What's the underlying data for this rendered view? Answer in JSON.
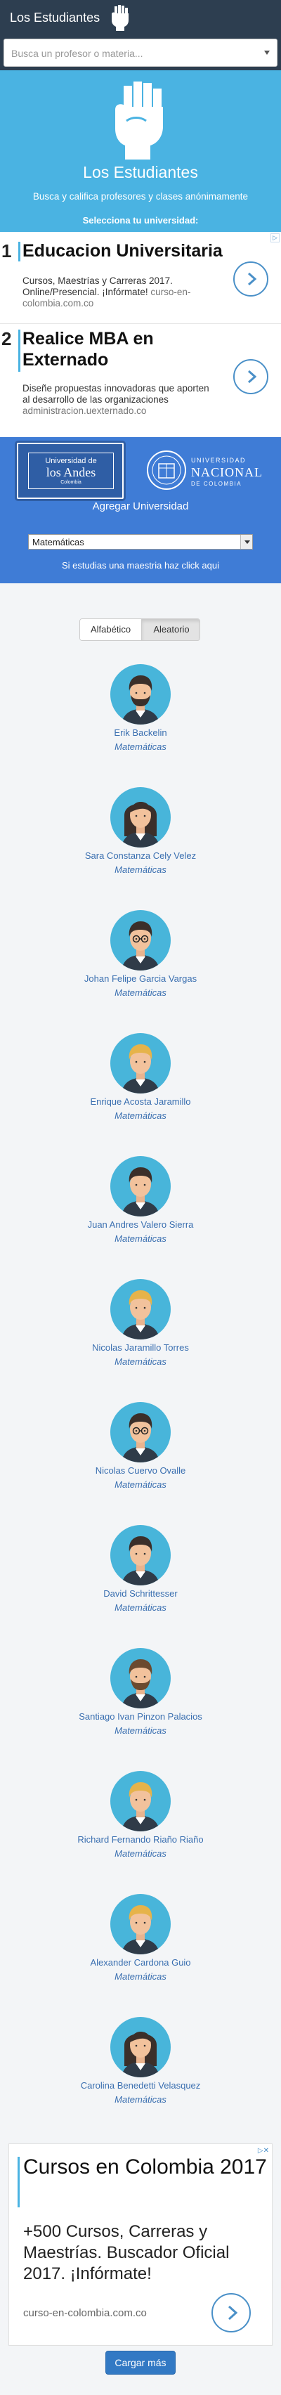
{
  "navbar": {
    "brand": "Los Estudiantes"
  },
  "search": {
    "placeholder": "Busca un profesor o materia..."
  },
  "hero": {
    "title": "Los Estudiantes",
    "subtitle": "Busca y califica profesores y clases anónimamente",
    "select_prompt": "Selecciona tu universidad:"
  },
  "ads": [
    {
      "number": "1",
      "title": "Educacion Universitaria",
      "text": "Cursos, Maestrías y Carreras 2017. Online/Presencial. ¡Infórmate!",
      "url": "curso-en-colombia.com.co"
    },
    {
      "number": "2",
      "title": "Realice MBA en Externado",
      "text": "Diseñe propuestas innovadoras que aporten al desarrollo de las organizaciones",
      "url": "administracion.uexternado.co"
    }
  ],
  "universities": {
    "uandes": {
      "line1": "Universidad de",
      "line2": "los Andes",
      "line3": "Colombia"
    },
    "unal": {
      "line1": "UNIVERSIDAD",
      "line2": "NACIONAL",
      "line3": "DE COLOMBIA"
    },
    "add_label": "Agregar Universidad",
    "selected_department": "Matemáticas",
    "maestria_link": "Si estudias una maestria haz click aqui"
  },
  "sort": {
    "alphabetic": "Alfabético",
    "random": "Aleatorio",
    "active": "random"
  },
  "colors": {
    "navbar": "#2d3e50",
    "hero": "#4ab3e2",
    "uni_bg": "#3f7cd6",
    "link": "#3a6fb0",
    "avatar_circle": "#48b5da"
  },
  "professors": [
    {
      "name": "Erik Backelin",
      "department": "Matemáticas",
      "avatar": "male-beard-dark-hair"
    },
    {
      "name": "Sara Constanza Cely Velez",
      "department": "Matemáticas",
      "avatar": "female-dark-hair"
    },
    {
      "name": "Johan Felipe Garcia Vargas",
      "department": "Matemáticas",
      "avatar": "male-dark-hair-glasses"
    },
    {
      "name": "Enrique Acosta Jaramillo",
      "department": "Matemáticas",
      "avatar": "male-blond-hair"
    },
    {
      "name": "Juan Andres Valero Sierra",
      "department": "Matemáticas",
      "avatar": "male-dark-hair"
    },
    {
      "name": "Nicolas Jaramillo Torres",
      "department": "Matemáticas",
      "avatar": "male-blond-hair"
    },
    {
      "name": "Nicolas Cuervo Ovalle",
      "department": "Matemáticas",
      "avatar": "male-dark-hair-glasses"
    },
    {
      "name": "David Schrittesser",
      "department": "Matemáticas",
      "avatar": "male-dark-hair"
    },
    {
      "name": "Santiago Ivan Pinzon Palacios",
      "department": "Matemáticas",
      "avatar": "male-brown-hair-mustache"
    },
    {
      "name": "Richard Fernando Riaño Riaño",
      "department": "Matemáticas",
      "avatar": "male-blond-hair"
    },
    {
      "name": "Alexander Cardona Guio",
      "department": "Matemáticas",
      "avatar": "male-blond-hair"
    },
    {
      "name": "Carolina Benedetti Velasquez",
      "department": "Matemáticas",
      "avatar": "female-dark-hair"
    }
  ],
  "bottom_ad": {
    "title": "Cursos en Colombia 2017",
    "text": "+500 Cursos, Carreras y Maestrías. Buscador Oficial 2017. ¡Infórmate!",
    "url": "curso-en-colombia.com.co"
  },
  "load_more": "Cargar más"
}
